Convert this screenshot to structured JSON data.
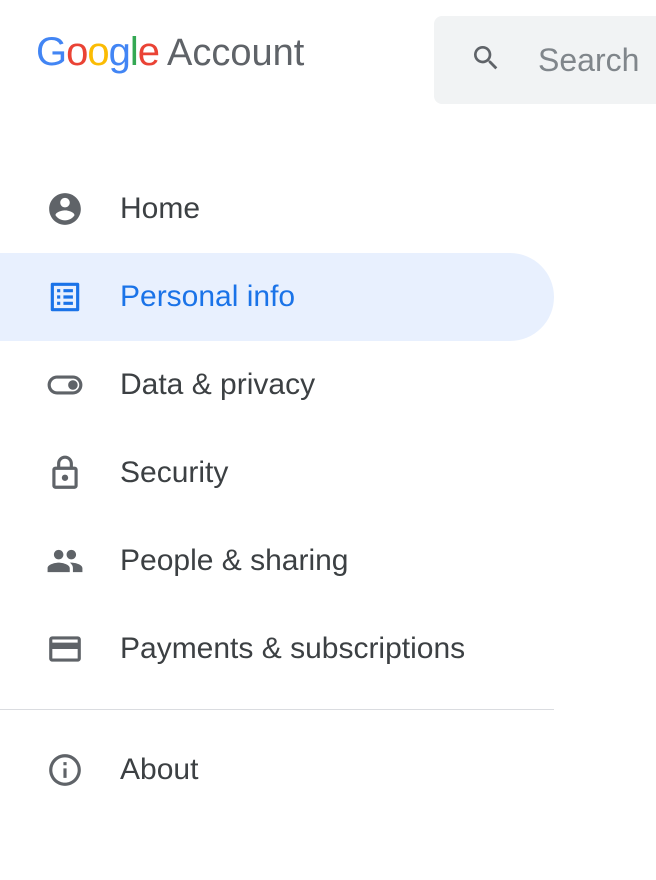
{
  "header": {
    "logo_text": "Google",
    "product_label": "Account"
  },
  "search": {
    "placeholder": "Search"
  },
  "sidebar": {
    "items": [
      {
        "label": "Home",
        "icon": "home-icon",
        "active": false
      },
      {
        "label": "Personal info",
        "icon": "personal-info-icon",
        "active": true
      },
      {
        "label": "Data & privacy",
        "icon": "toggle-icon",
        "active": false
      },
      {
        "label": "Security",
        "icon": "lock-icon",
        "active": false
      },
      {
        "label": "People & sharing",
        "icon": "people-icon",
        "active": false
      },
      {
        "label": "Payments & subscriptions",
        "icon": "payment-icon",
        "active": false
      }
    ],
    "footer_items": [
      {
        "label": "About",
        "icon": "info-icon",
        "active": false
      }
    ]
  }
}
